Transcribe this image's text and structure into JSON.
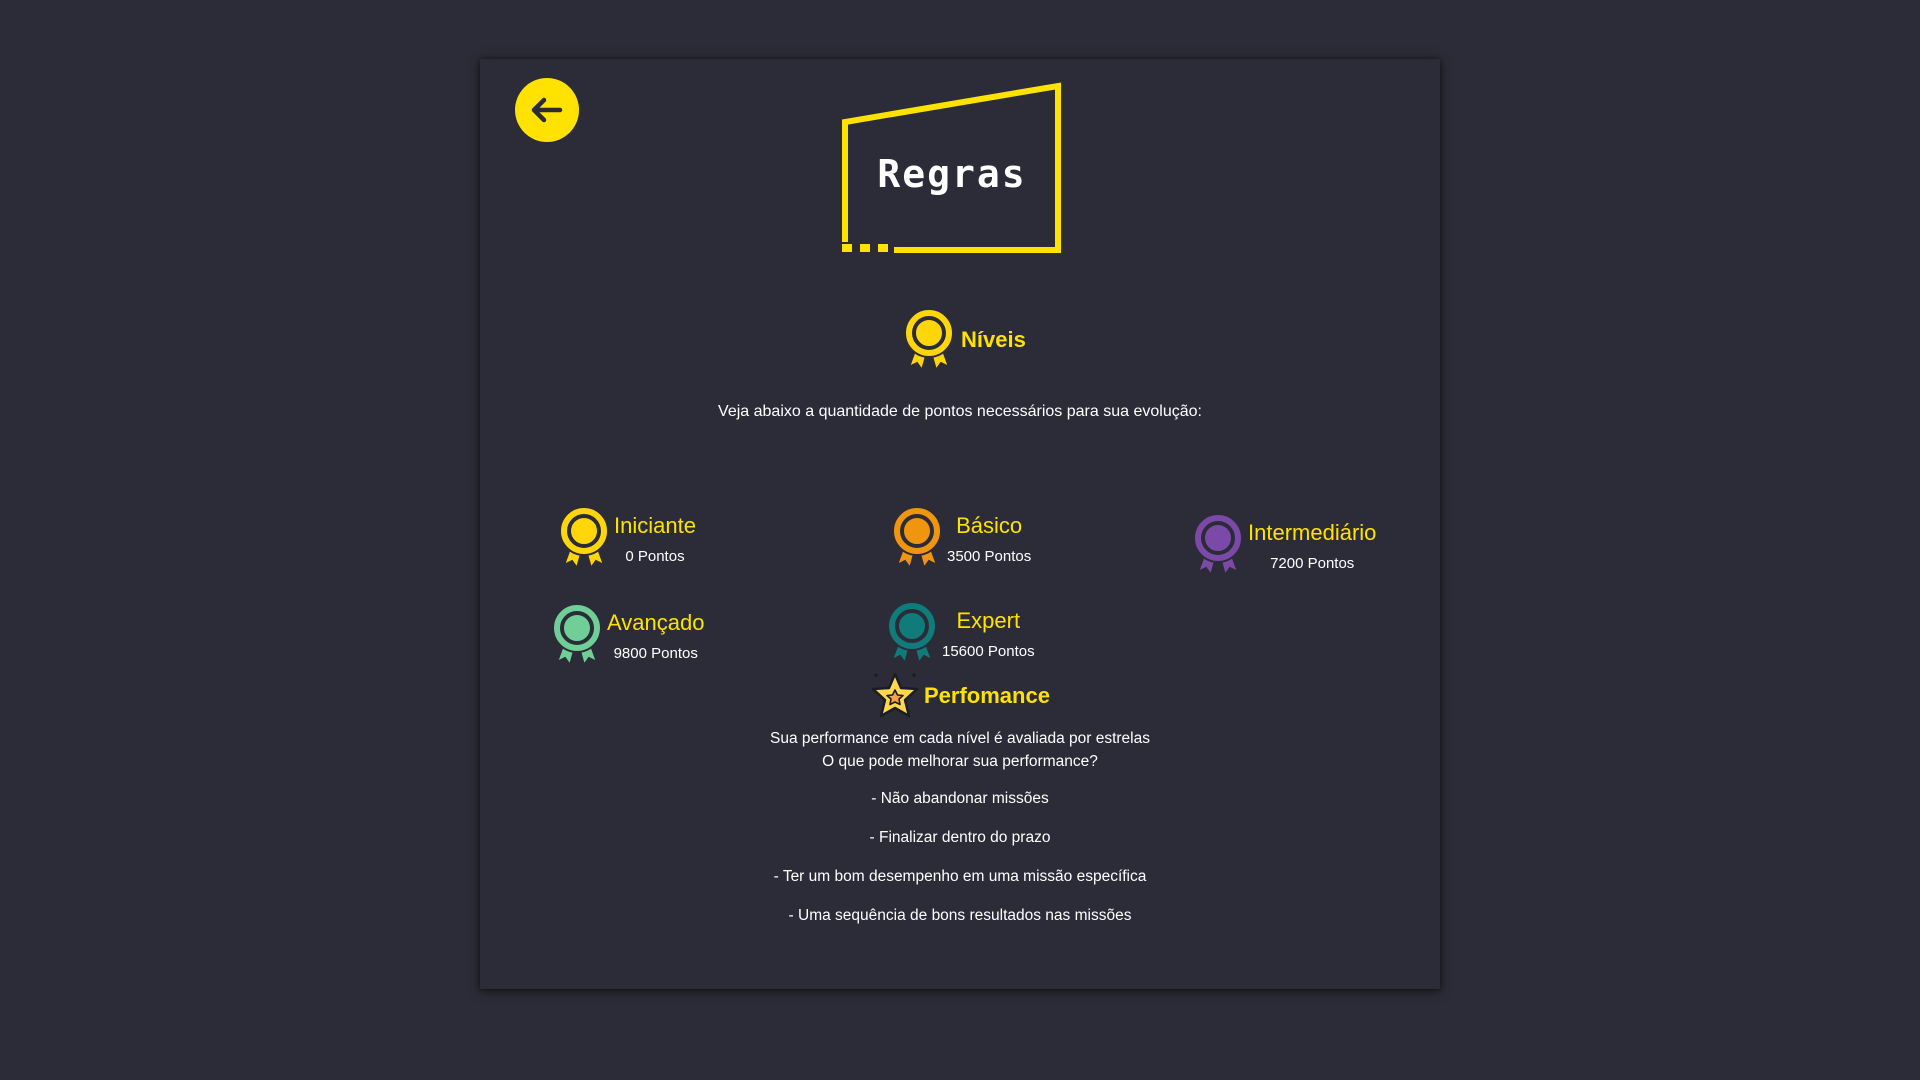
{
  "header": {
    "back_icon": "arrow-left-icon",
    "title": "Regras"
  },
  "colors": {
    "background": "#2b2c37",
    "accent": "#ffe200",
    "iniciante": "#ffd60a",
    "basico": "#f0960e",
    "intermediario": "#7b49a7",
    "avancado": "#6fcf97",
    "expert": "#0f7b7b"
  },
  "levels_section": {
    "icon": "medal-icon",
    "title": "Níveis",
    "intro": "Veja abaixo a quantidade de pontos necessários para sua evolução:",
    "levels": [
      {
        "name": "Iniciante",
        "points": "0 Pontos",
        "icon": "medal-icon"
      },
      {
        "name": "Básico",
        "points": "3500 Pontos",
        "icon": "medal-icon"
      },
      {
        "name": "Intermediário",
        "points": "7200 Pontos",
        "icon": "medal-icon"
      },
      {
        "name": "Avançado",
        "points": "9800 Pontos",
        "icon": "medal-icon"
      },
      {
        "name": "Expert",
        "points": "15600 Pontos",
        "icon": "medal-icon"
      }
    ]
  },
  "performance_section": {
    "icon": "star-icon",
    "title": "Perfomance",
    "line1": "Sua performance em cada nível é avaliada por estrelas",
    "line2": "O que pode melhorar sua performance?",
    "items": [
      "- Não abandonar missões",
      "- Finalizar dentro do prazo",
      "- Ter um bom desempenho em uma missão específica",
      "- Uma sequência de bons resultados nas missões"
    ]
  }
}
